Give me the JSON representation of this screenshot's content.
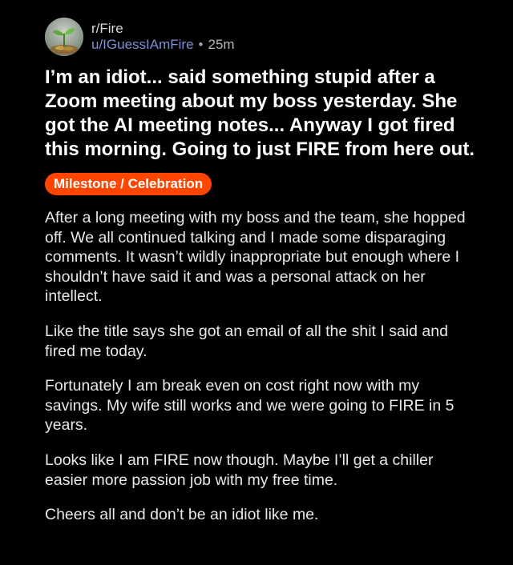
{
  "post": {
    "subreddit": "r/Fire",
    "username": "u/IGuessIAmFire",
    "separator": "•",
    "time_ago": "25m",
    "avatar_icon": "plant-sprout-icon",
    "title": "I’m an idiot... said something stupid after a Zoom meeting about my boss yesterday. She got the AI meeting notes... Anyway I got fired this morning. Going to just FIRE from here out.",
    "flair": "Milestone / Celebration",
    "flair_color": "#ff4500",
    "paragraphs": [
      "After a long meeting with my boss and the team, she hopped off. We all continued talking and I made some disparaging comments. It wasn’t wildly inappropriate but enough where I shouldn’t have said it and was a personal attack on her intellect.",
      "Like the title says she got an email of all the shit I said and fired me today.",
      "Fortunately I am break even on cost right now with my savings. My wife still works and we were going to FIRE in 5 years.",
      "Looks like I am FIRE now though. Maybe I’ll get a chiller easier more passion job with my free time.",
      "Cheers all and don’t be an idiot like me."
    ]
  }
}
